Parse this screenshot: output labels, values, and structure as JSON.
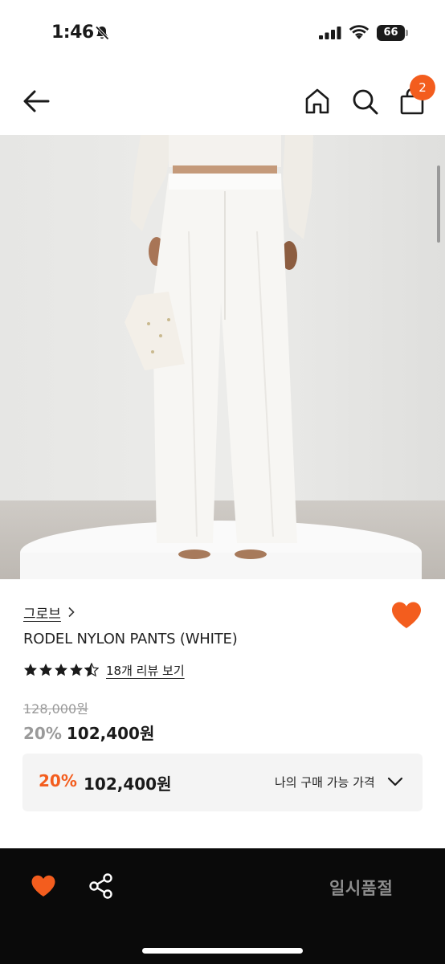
{
  "status_bar": {
    "time": "1:46",
    "battery": "66"
  },
  "header": {
    "cart_count": "2"
  },
  "product": {
    "brand": "그로브",
    "title": "RODEL NYLON PANTS (WHITE)",
    "rating": 4.5,
    "review_link": "18개 리뷰 보기",
    "original_price": "128,000원",
    "discount_rate": "20%",
    "sale_price": "102,400원"
  },
  "my_price": {
    "discount_rate": "20%",
    "price": "102,400원",
    "label": "나의 구매 가능 가격"
  },
  "bottom_bar": {
    "status_label": "일시품절"
  },
  "colors": {
    "accent": "#f35d1e",
    "text": "#1a1a1a",
    "muted": "#9a9a9a",
    "bottom_bar_bg": "#0a0a0a"
  },
  "icons": [
    "bell-off-icon",
    "signal-icon",
    "wifi-icon",
    "battery-icon",
    "back-arrow-icon",
    "home-icon",
    "search-icon",
    "cart-icon",
    "chevron-right-icon",
    "heart-icon",
    "star-icon",
    "chevron-down-icon",
    "share-icon"
  ]
}
